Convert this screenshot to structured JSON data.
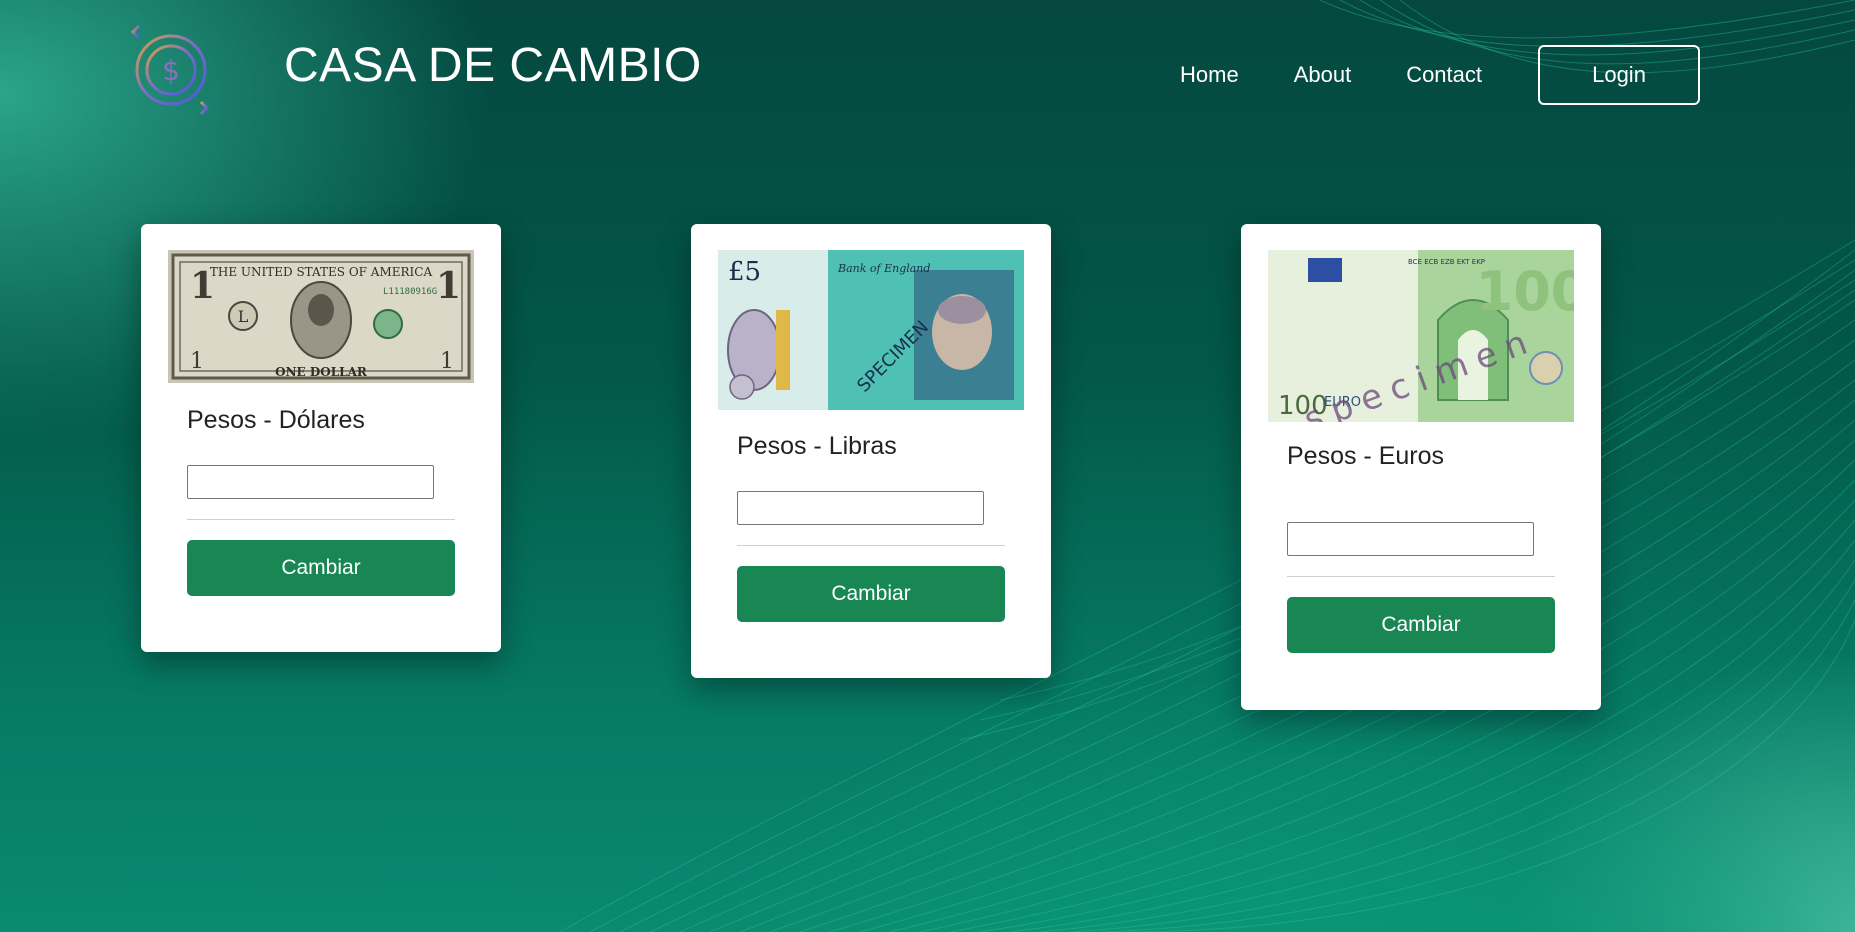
{
  "header": {
    "title": "CASA DE CAMBIO",
    "logo_icon": "currency-exchange-icon",
    "nav": [
      {
        "label": "Home"
      },
      {
        "label": "About"
      },
      {
        "label": "Contact"
      }
    ],
    "login_label": "Login"
  },
  "cards": [
    {
      "title": "Pesos - Dólares",
      "bill": {
        "icon": "dollar-bill-image",
        "denomination": "1",
        "text_top": "THE UNITED STATES OF AMERICA",
        "text_bottom": "ONE DOLLAR",
        "serial": "L11180916G"
      },
      "input_value": "",
      "button_label": "Cambiar"
    },
    {
      "title": "Pesos - Libras",
      "bill": {
        "icon": "pound-note-image",
        "denomination": "£5",
        "watermark": "SPECIMEN",
        "issuer": "Bank of England"
      },
      "input_value": "",
      "button_label": "Cambiar"
    },
    {
      "title": "Pesos - Euros",
      "bill": {
        "icon": "euro-note-image",
        "denomination": "100",
        "currency": "EURO",
        "watermark": "specimen",
        "codes": "BCE ECB EZB EKT EKP"
      },
      "input_value": "",
      "button_label": "Cambiar"
    }
  ],
  "colors": {
    "accent": "#198754",
    "background_dark": "#04483f",
    "background_light": "#0a8a70"
  }
}
